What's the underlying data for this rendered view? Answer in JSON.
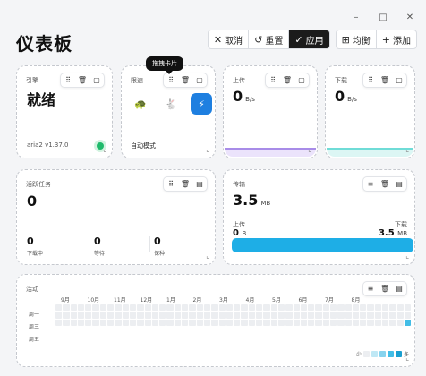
{
  "window": {
    "minimize": "–",
    "maximize": "□",
    "close": "✕"
  },
  "page_title": "仪表板",
  "toolbar": {
    "cancel": "取消",
    "reset": "重置",
    "apply": "应用",
    "balance": "均衡",
    "add": "添加"
  },
  "tooltip": "拖拽卡片",
  "engine_card": {
    "label": "引擎",
    "status": "就绪",
    "version": "aria2 v1.37.0"
  },
  "speed_card": {
    "label": "限速",
    "mode": "自动模式"
  },
  "upload_card": {
    "label": "上传",
    "value": "0",
    "unit": "B/s"
  },
  "download_card": {
    "label": "下载",
    "value": "0",
    "unit": "B/s"
  },
  "tasks_card": {
    "label": "活跃任务",
    "value": "0",
    "stats": [
      {
        "value": "0",
        "label": "下载中"
      },
      {
        "value": "0",
        "label": "等待"
      },
      {
        "value": "0",
        "label": "保种"
      }
    ]
  },
  "transfer_card": {
    "label": "传输",
    "value": "3.5",
    "unit": "MB",
    "upload_label": "上传",
    "upload_value": "0",
    "upload_unit": "B",
    "download_label": "下载",
    "download_value": "3.5",
    "download_unit": "MB"
  },
  "activity_card": {
    "label": "活动",
    "months": [
      "9月",
      "10月",
      "11月",
      "12月",
      "1月",
      "2月",
      "3月",
      "4月",
      "5月",
      "6月",
      "7月",
      "8月"
    ],
    "days": [
      "周一",
      "周三",
      "周五"
    ],
    "legend_less": "少",
    "legend_more": "多"
  },
  "colors": {
    "accent": "#1e7fe0",
    "upload_stripe": "#c9b6f2",
    "download_stripe": "#b5ecea",
    "bar": "#1eaee6",
    "status_ok": "#1fba6b"
  }
}
